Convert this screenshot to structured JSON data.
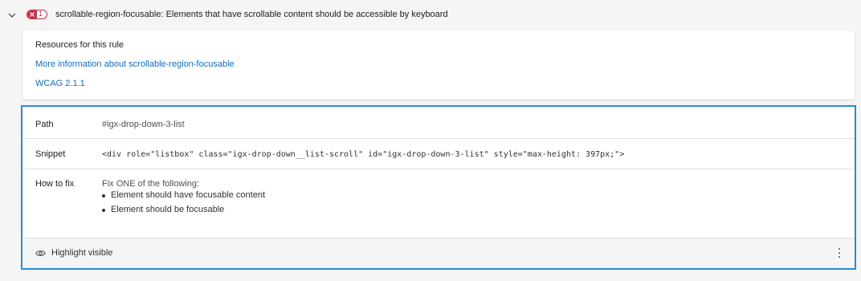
{
  "rule": {
    "failure_count": "1",
    "id": "scrollable-region-focusable",
    "separator": ":",
    "description": " Elements that have scrollable content should be accessible by keyboard",
    "expand_icon": "chevron-down-icon",
    "status_icon": "error-x-icon",
    "status_color": "#c4314b"
  },
  "resources": {
    "heading": "Resources for this rule",
    "links": [
      {
        "label": "More information about scrollable-region-focusable"
      },
      {
        "label": "WCAG 2.1.1"
      }
    ],
    "link_color": "#0f6cbd"
  },
  "details": {
    "accent_border": "#2b88d8",
    "path": {
      "label": "Path",
      "value": "#igx-drop-down-3-list"
    },
    "snippet": {
      "label": "Snippet",
      "value": "<div role=\"listbox\" class=\"igx-drop-down__list-scroll\" id=\"igx-drop-down-3-list\" style=\"max-height: 397px;\">"
    },
    "how_to_fix": {
      "label": "How to fix",
      "intro": "Fix ONE of the following:",
      "items": [
        "Element should have focusable content",
        "Element should be focusable"
      ]
    },
    "footer": {
      "highlight_label": "Highlight visible",
      "highlight_icon": "eye-icon",
      "more_icon": "more-vertical-icon"
    }
  }
}
